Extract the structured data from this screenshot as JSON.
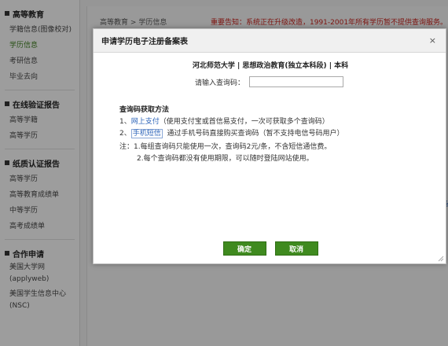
{
  "breadcrumb": {
    "home": "高等教育",
    "sep": ">",
    "current": "学历信息"
  },
  "notice": "重要告知：系统正在升级改造，1991-2001年所有学历暂不提供查询服务。",
  "sidebar": {
    "groups": [
      {
        "title": "高等教育",
        "items": [
          "学籍信息(图像校对)",
          "学历信息",
          "考研信息",
          "毕业去向"
        ],
        "active_index": 1
      },
      {
        "title": "在线验证报告",
        "items": [
          "高等学籍",
          "高等学历"
        ]
      },
      {
        "title": "纸质认证报告",
        "items": [
          "高等学历",
          "高等教育成绩单",
          "中等学历",
          "高考成绩单"
        ]
      },
      {
        "title": "合作申请",
        "items": [
          "美国大学网 (applyweb)",
          "美国学生信息中心 (NSC)"
        ]
      }
    ]
  },
  "dialog": {
    "title": "申请学历电子注册备案表",
    "close": "×",
    "school_line": "河北师范大学 | 思想政治教育(独立本科段) | 本科",
    "code_label": "请输入查询码：",
    "code_value": "",
    "how_title": "查询码获取方法",
    "method1_prefix": "1、",
    "method1_link": "网上支付",
    "method1_text": "（使用支付宝或首信易支付，一次可获取多个查询码）",
    "method2_prefix": "2、",
    "method2_link": "手机短信",
    "method2_text": "通过手机号码直接购买查询码（暂不支持电信号码用户）",
    "note1": "注：1.每组查询码只能使用一次，查询码2元/条，不含短信通信费。",
    "note2": "2.每个查询码都没有使用期限，可以随时登陆网站使用。",
    "confirm": "确定",
    "cancel": "取消"
  },
  "right_edge_text": "备"
}
